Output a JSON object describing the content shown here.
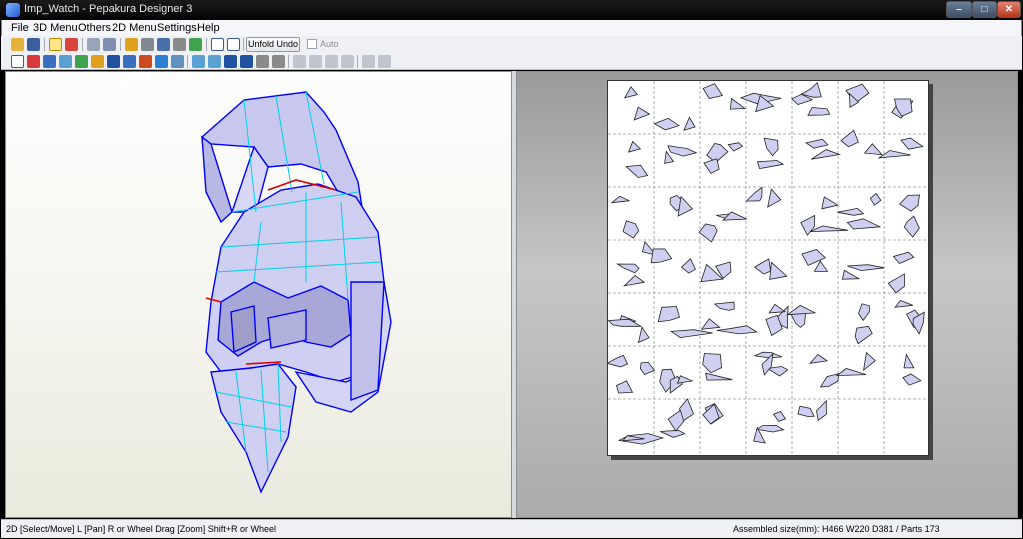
{
  "window": {
    "title": "Imp_Watch - Pepakura Designer 3"
  },
  "menu": {
    "items": [
      "File",
      "3D Menu",
      "Others",
      "2D Menu",
      "Settings",
      "Help"
    ]
  },
  "toolbar": {
    "unfold_undo_label": "Unfold Undo",
    "auto_label": "Auto",
    "auto_checked": false
  },
  "status": {
    "left": "2D [Select/Move] L [Pan] R or Wheel Drag [Zoom] Shift+R or Wheel",
    "right": "Assembled size(mm): H466 W220 D381 / Parts 173"
  },
  "colors": {
    "part_fill": "#cfcff2",
    "edge_blue": "#0000ff",
    "edge_cyan": "#00d0e8",
    "edge_red": "#e00000"
  }
}
